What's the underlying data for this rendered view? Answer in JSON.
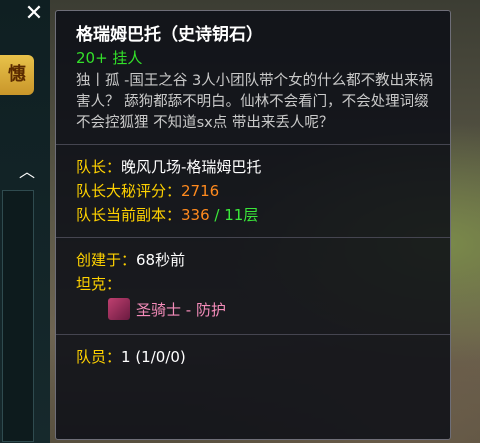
{
  "background": {
    "close_glyph": "✕",
    "side_button_label": "憓",
    "chevron_glyph": "︿"
  },
  "tooltip": {
    "title": "格瑞姆巴托（史诗钥石）",
    "subtitle": "20+ 挂人",
    "description": "独丨孤 -国王之谷 3人小团队带个女的什么都不教出来祸害人？ 舔狗都舔不明白。仙林不会看门，不会处理词缀 不会控狐狸 不知道sx点 带出来丢人呢？",
    "leader": {
      "label": "队长：",
      "value": "晚风几场-格瑞姆巴托"
    },
    "leader_score": {
      "label": "队长大秘评分：",
      "value": "2716"
    },
    "leader_dungeon": {
      "label": "队长当前副本：",
      "value1": "336",
      "separator": " / ",
      "value2": "11层"
    },
    "created": {
      "label": "创建于：",
      "value": "68秒前"
    },
    "tank": {
      "label": "坦克：",
      "role_text": "圣骑士 - 防护"
    },
    "members": {
      "label": "队员：",
      "value": "1 (1/0/0)"
    }
  },
  "colors": {
    "title": "#ffffff",
    "subtitle_green": "#33e02a",
    "label_yellow": "#ffd200",
    "value_orange": "#ff8a1e",
    "value_green": "#3be83a",
    "paladin_pink": "#f58cba"
  }
}
